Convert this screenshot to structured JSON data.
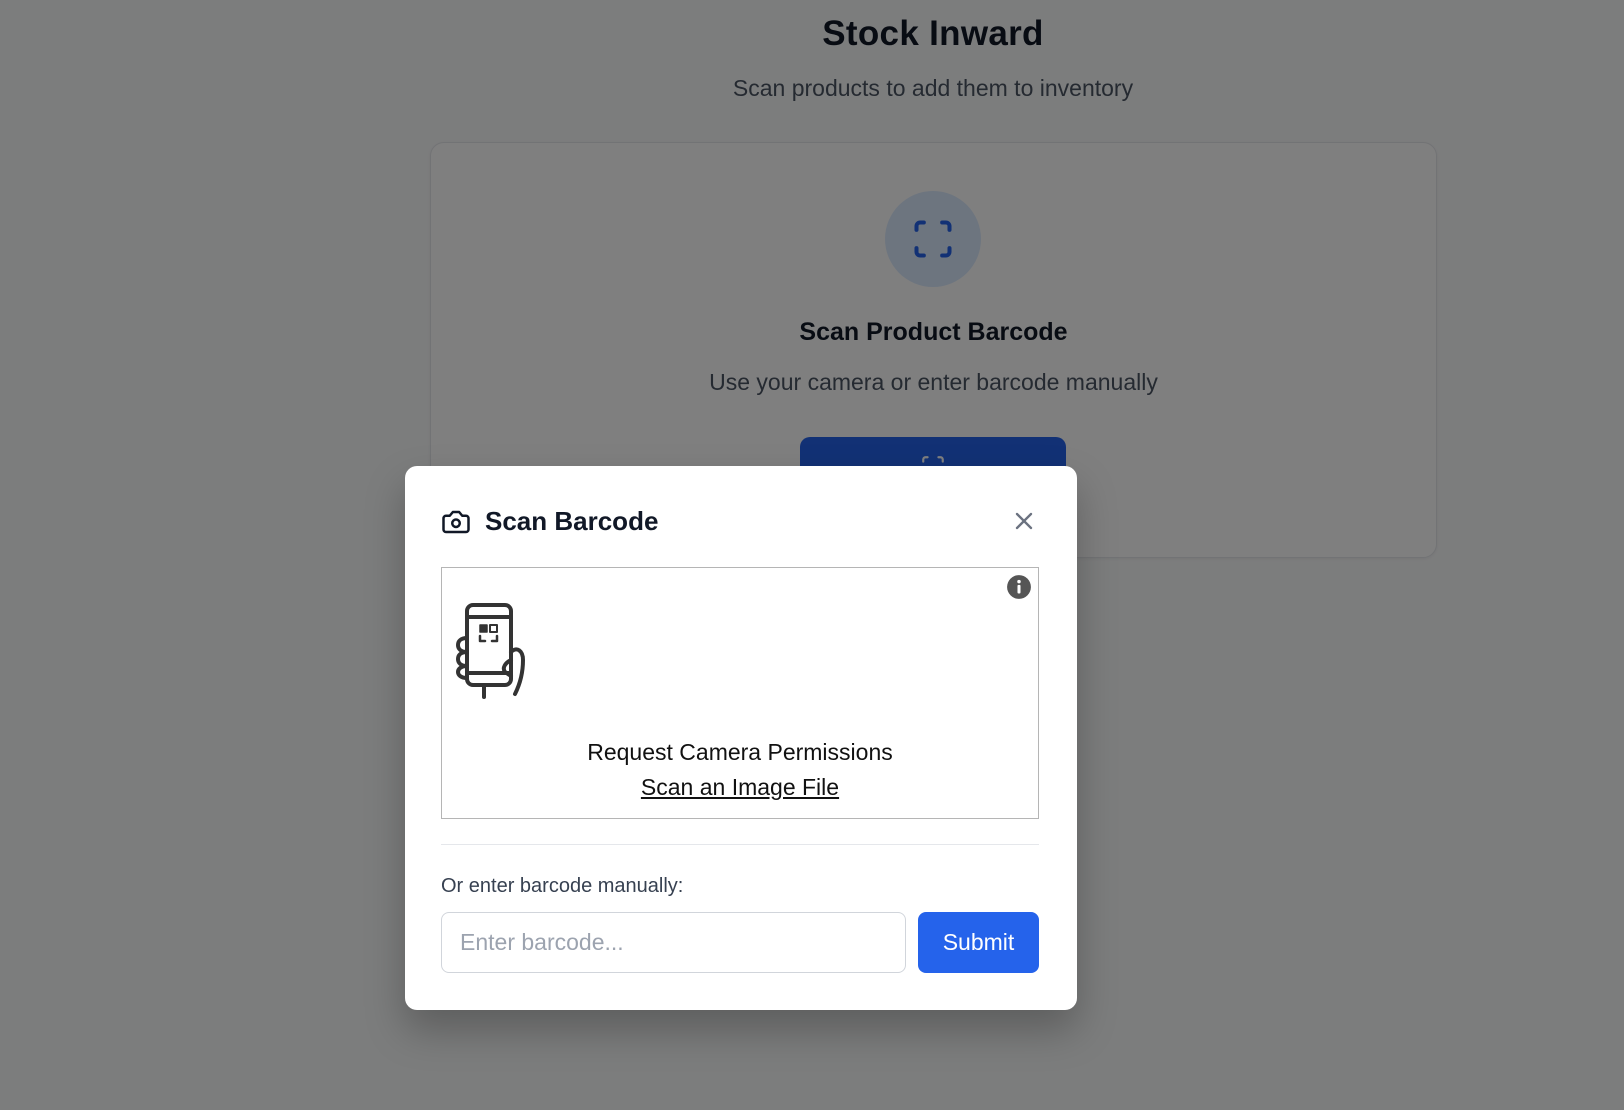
{
  "page": {
    "title": "Stock Inward",
    "subtitle": "Scan products to add them to inventory"
  },
  "scan_card": {
    "icon": "scan-icon",
    "title": "Scan Product Barcode",
    "subtitle": "Use your camera or enter barcode manually",
    "button_icon": "scan-icon"
  },
  "modal": {
    "title_icon": "camera-icon",
    "title": "Scan Barcode",
    "close_icon": "close-icon",
    "scanner": {
      "info_icon": "info-icon",
      "illustration": "phone-qr-icon",
      "permission_label": "Request Camera Permissions",
      "file_link_label": "Scan an Image File"
    },
    "manual_label": "Or enter barcode manually:",
    "input": {
      "value": "",
      "placeholder": "Enter barcode..."
    },
    "submit_label": "Submit"
  },
  "colors": {
    "accent": "#2563eb",
    "overlay": "rgba(0,0,0,0.5)",
    "scan_circle": "#dbeafe"
  }
}
